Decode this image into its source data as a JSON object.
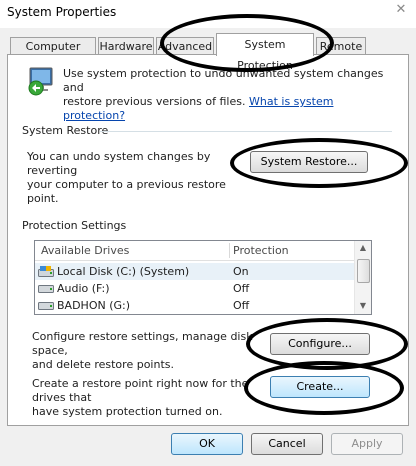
{
  "window": {
    "title": "System Properties",
    "close_glyph": "✕"
  },
  "tabs": [
    {
      "label": "Computer Name"
    },
    {
      "label": "Hardware"
    },
    {
      "label": "Advanced"
    },
    {
      "label": "System Protection",
      "active": true
    },
    {
      "label": "Remote"
    }
  ],
  "intro": {
    "line1": "Use system protection to undo unwanted system changes and",
    "line2_prefix": "restore previous versions of files. ",
    "link": "What is system protection?"
  },
  "system_restore": {
    "heading": "System Restore",
    "line1": "You can undo system changes by reverting",
    "line2": "your computer to a previous restore point.",
    "button": "System Restore..."
  },
  "protection_settings": {
    "heading": "Protection Settings",
    "columns": [
      "Available Drives",
      "Protection"
    ],
    "drives": [
      {
        "name": "Local Disk (C:) (System)",
        "protection": "On",
        "icon": "system-drive-icon",
        "selected": true
      },
      {
        "name": "Audio (F:)",
        "protection": "Off",
        "icon": "drive-icon"
      },
      {
        "name": "BADHON (G:)",
        "protection": "Off",
        "icon": "drive-icon"
      }
    ],
    "configure_line1": "Configure restore settings, manage disk space,",
    "configure_line2": "and delete restore points.",
    "configure_button": "Configure...",
    "create_line1": "Create a restore point right now for the drives that",
    "create_line2": "have system protection turned on.",
    "create_button": "Create..."
  },
  "footer": {
    "ok": "OK",
    "cancel": "Cancel",
    "apply": "Apply"
  },
  "colors": {
    "link": "#0645ad",
    "panel_bg": "#ffffff",
    "window_bg": "#f0f0f0",
    "annotation": "#000000"
  }
}
